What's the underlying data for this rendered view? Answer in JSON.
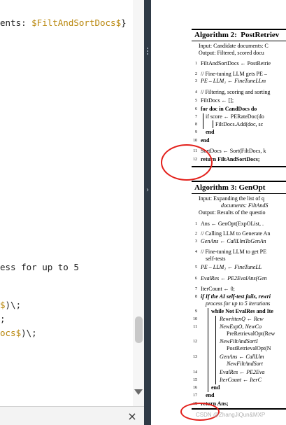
{
  "editor": {
    "lines": [
      {
        "plain": "ents: ",
        "dollar": "$FiltAndSortDocs$",
        "tail": "}"
      },
      {
        "plain": "ess for up to 5",
        "dollar": "",
        "tail": ""
      },
      {
        "plain": "",
        "dollar": "$",
        "tail": ")\\;"
      },
      {
        "plain": ";",
        "dollar": "",
        "tail": ""
      },
      {
        "plain": "",
        "dollar": "ocs$",
        "tail": ")\\;"
      }
    ],
    "close_label": "×"
  },
  "splitter": {
    "arrow": "›"
  },
  "paper": {
    "algo2": {
      "title": "Algorithm 2:  PostRetriev",
      "input": "Input: Candidate documents: C",
      "output": "Output: Filtered, scored docu",
      "lines": [
        {
          "n": "1",
          "t": "FiltAndSortDocs ← PostRetrie"
        },
        {
          "n": "2",
          "t": "// Fine-tuning LLM gets PE –"
        },
        {
          "n": "3",
          "t": "PE – LLM₁ ← FineTuneLLm"
        },
        {
          "n": "4",
          "t": "// Filtering, scoring and sorting"
        },
        {
          "n": "5",
          "t": "FiltDocs ← [];"
        },
        {
          "n": "6",
          "t": "for doc in CandDocs do"
        },
        {
          "n": "7",
          "t": "if score ← PERateDoc(do"
        },
        {
          "n": "8",
          "t": "FiltDocs.Add(doc, sc"
        },
        {
          "n": "9",
          "t": "end"
        },
        {
          "n": "10",
          "t": "end"
        },
        {
          "n": "11",
          "t": "SortDocs ← Sort(FiltDocs, k"
        },
        {
          "n": "12",
          "t": "return FiltAndSortDocs;"
        }
      ]
    },
    "algo3": {
      "title": "Algorithm 3: GenOpt",
      "input": "Input: Expanding the list of q",
      "input2": "documents: FiltAndS",
      "output": "Output: Results of the questio",
      "lines": [
        {
          "n": "1",
          "t": "Ans ← GenOpt(ExpOList, ."
        },
        {
          "n": "2",
          "t": "// Calling LLM to Generate An"
        },
        {
          "n": "3",
          "t": "GenAns ← CallLlmToGenAn"
        },
        {
          "n": "4",
          "t": "// Fine-tuning LLM to get PE"
        },
        {
          "n": "",
          "t": "self-tests"
        },
        {
          "n": "5",
          "t": "PE – LLM₂ ← FineTuneLL"
        },
        {
          "n": "6",
          "t": "EvalRes ← PE2EvalAns(Gen"
        },
        {
          "n": "7",
          "t": "IterCount ← 0;"
        },
        {
          "n": "8",
          "t": "if If the AI self-test fails, rewri"
        },
        {
          "n": "",
          "t": "process for up to 5 iterations"
        },
        {
          "n": "9",
          "t": "while Not EvalRes and Ite"
        },
        {
          "n": "10",
          "t": "RewrittenQ ← Rew"
        },
        {
          "n": "11",
          "t": "NewExpO, NewCo"
        },
        {
          "n": "",
          "t": "PreRetrievalOpt(Rew"
        },
        {
          "n": "12",
          "t": "NewFiltAndSortI"
        },
        {
          "n": "",
          "t": "PostRetrievalOpt(N"
        },
        {
          "n": "13",
          "t": "GenAns ← CallLlm"
        },
        {
          "n": "",
          "t": "NewFiltAndSort"
        },
        {
          "n": "14",
          "t": "EvalRes ← PE2Eva"
        },
        {
          "n": "15",
          "t": "IterCount ← IterC"
        },
        {
          "n": "16",
          "t": "end"
        },
        {
          "n": "17",
          "t": "end"
        },
        {
          "n": "18",
          "t": "return Ans;"
        }
      ]
    },
    "watermark": "CSDN @ZhangJiQun&MXP"
  },
  "colors": {
    "annotation": "#e3201b",
    "splitter": "#2f3a46",
    "dollar": "#b8860b"
  }
}
